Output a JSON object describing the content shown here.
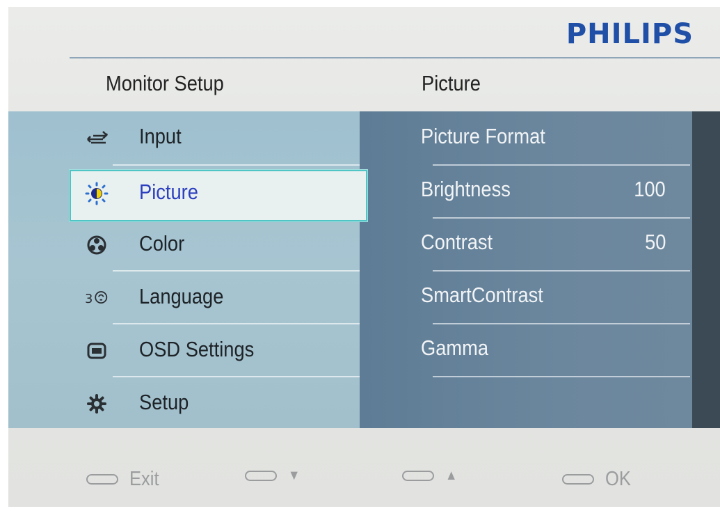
{
  "brand": "PHILIPS",
  "header": {
    "left": "Monitor Setup",
    "right": "Picture"
  },
  "menu": [
    {
      "label": "Input",
      "icon": "input-icon"
    },
    {
      "label": "Picture",
      "icon": "brightness-icon"
    },
    {
      "label": "Color",
      "icon": "color-wheel-icon"
    },
    {
      "label": "Language",
      "icon": "language-icon"
    },
    {
      "label": "OSD Settings",
      "icon": "osd-icon"
    },
    {
      "label": "Setup",
      "icon": "gear-icon"
    }
  ],
  "selected_menu": "Picture",
  "submenu": [
    {
      "label": "Picture Format",
      "value": ""
    },
    {
      "label": "Brightness",
      "value": "100"
    },
    {
      "label": "Contrast",
      "value": "50"
    },
    {
      "label": "SmartContrast",
      "value": ""
    },
    {
      "label": "Gamma",
      "value": ""
    }
  ],
  "footer": [
    {
      "label": "Exit"
    },
    {
      "label": "▼"
    },
    {
      "label": "▲"
    },
    {
      "label": "OK"
    }
  ],
  "colors": {
    "brand": "#1f4fa6",
    "selection_border": "#4fc5c5",
    "selected_text": "#2b3fbf"
  }
}
